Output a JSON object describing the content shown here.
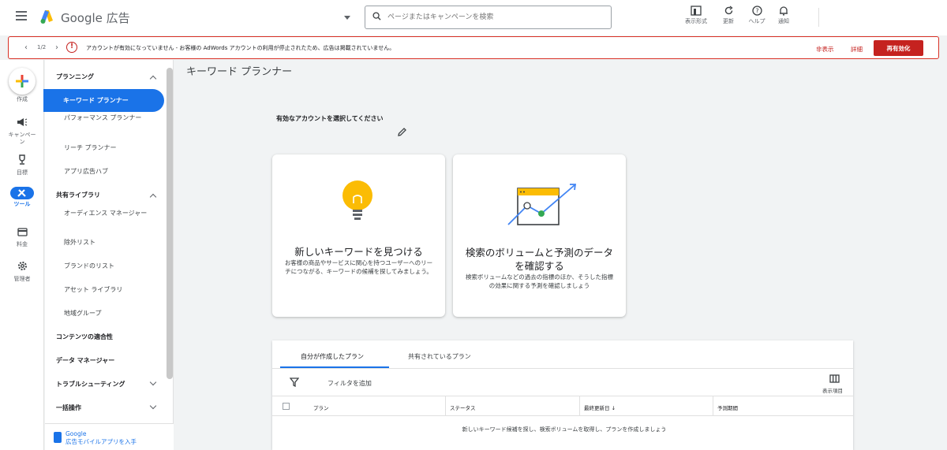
{
  "topbar": {
    "brand": "Google 広告",
    "search_placeholder": "ページまたはキャンペーンを検索",
    "buttons": [
      {
        "label": "表示形式",
        "icon": "appearance-icon"
      },
      {
        "label": "更新",
        "icon": "refresh-icon"
      },
      {
        "label": "ヘルプ",
        "icon": "help-icon"
      },
      {
        "label": "通知",
        "icon": "bell-icon"
      }
    ]
  },
  "alert": {
    "pager": "1/2",
    "message": "アカウントが有効になっていません - お客様の AdWords アカウントの利用が停止されたため、広告は掲載されていません。",
    "dismiss": "非表示",
    "details": "詳細",
    "reenable": "再有効化",
    "color": "#c5221f"
  },
  "rail": {
    "create": "作成",
    "campaigns": "キャンペーン",
    "goals": "目標",
    "tools": "ツール",
    "billing": "料金",
    "admin": "管理者"
  },
  "nav": {
    "planning": "プランニング",
    "keyword_planner": "キーワード プランナー",
    "performance_planner": "パフォーマンス プランナー",
    "reach_planner": "リーチ プランナー",
    "app_ad_hub": "アプリ広告ハブ",
    "shared_library": "共有ライブラリ",
    "audience_manager": "オーディエンス マネージャー",
    "exclusion_lists": "除外リスト",
    "brand_lists": "ブランドのリスト",
    "asset_library": "アセット ライブラリ",
    "location_groups": "地域グループ",
    "content_suitability": "コンテンツの適合性",
    "data_manager": "データ マネージャー",
    "troubleshooting": "トラブルシューティング",
    "bulk_actions": "一括操作",
    "footer_line1": "Google",
    "footer_line2": "広告モバイルアプリを入手"
  },
  "main": {
    "title": "キーワード プランナー",
    "select_account": "有効なアカウントを選択してください",
    "card1": {
      "title": "新しいキーワードを見つける",
      "desc": "お客様の商品やサービスに関心を持つユーザーへのリーチにつながる、キーワードの候補を探してみましょう。"
    },
    "card2": {
      "title": "検索のボリュームと予測のデータを確認する",
      "desc": "検索ボリュームなどの過去の指標のほか、そうした指標の効果に関する予測を確認しましょう"
    }
  },
  "plans": {
    "tab_mine": "自分が作成したプラン",
    "tab_shared": "共有されているプラン",
    "add_filter": "フィルタを追加",
    "columns": "表示項目",
    "headers": [
      "プラン",
      "ステータス",
      "最終更新日 ↓",
      "予測期間"
    ],
    "empty": "新しいキーワード候補を探し、検索ボリュームを取得し、プランを作成しましょう"
  }
}
